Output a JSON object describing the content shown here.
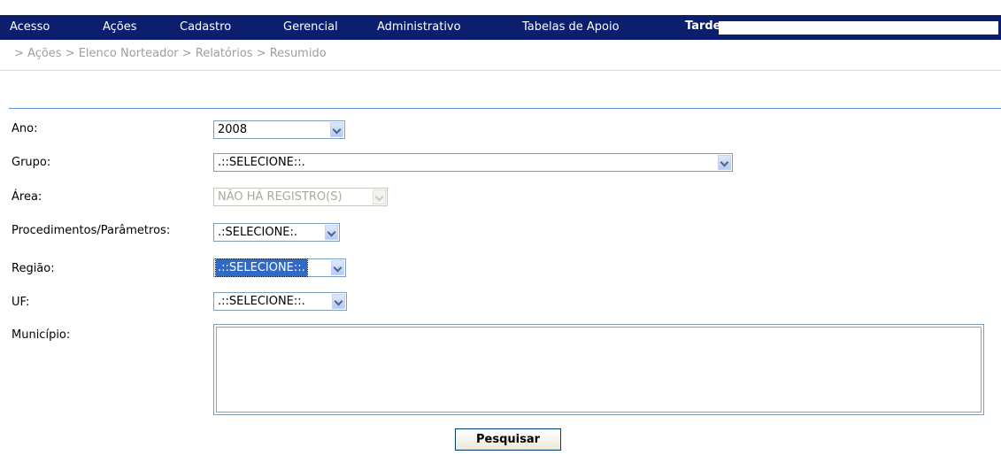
{
  "menu": {
    "items": [
      {
        "label": "Acesso"
      },
      {
        "label": "Ações"
      },
      {
        "label": "Cadastro"
      },
      {
        "label": "Gerencial"
      },
      {
        "label": "Administrativo"
      },
      {
        "label": "Tabelas de Apoio"
      }
    ],
    "greeting": "Tarde,"
  },
  "breadcrumb": "> Ações > Elenco Norteador > Relatórios > Resumido",
  "form": {
    "ano": {
      "label": "Ano:",
      "value": "2008"
    },
    "grupo": {
      "label": "Grupo:",
      "value": ".::SELECIONE::."
    },
    "area": {
      "label": "Área:",
      "value": "NÃO HÁ REGISTRO(S)"
    },
    "procedimentos": {
      "label": "Procedimentos/Parâmetros:",
      "value": ".:SELECIONE:."
    },
    "regiao": {
      "label": "Região:",
      "value": ".::SELECIONE::."
    },
    "uf": {
      "label": "UF:",
      "value": ".::SELECIONE::."
    },
    "municipio": {
      "label": "Município:"
    },
    "submit_label": "Pesquisar"
  }
}
